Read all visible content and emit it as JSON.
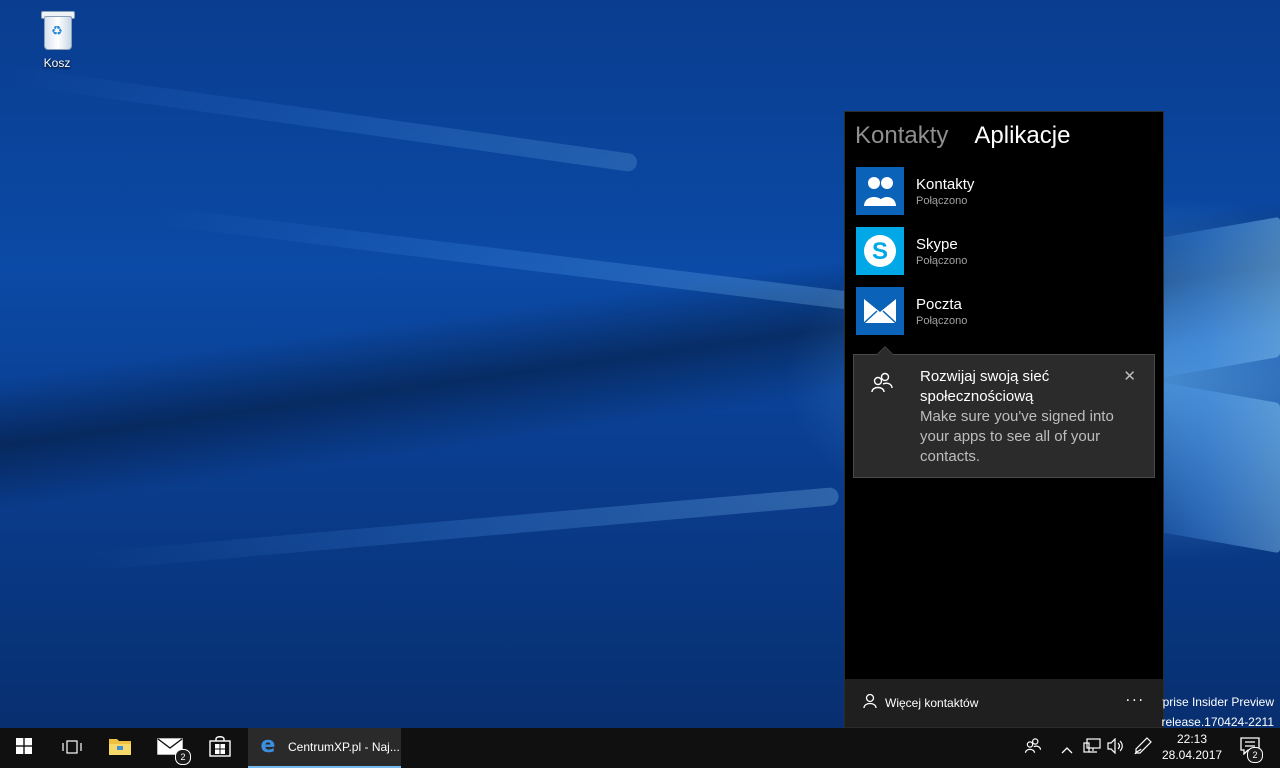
{
  "desktop": {
    "recycle_bin_label": "Kosz"
  },
  "people_panel": {
    "tabs": [
      {
        "label": "Kontakty",
        "active": false
      },
      {
        "label": "Aplikacje",
        "active": true
      }
    ],
    "apps": [
      {
        "name": "Kontakty",
        "status": "Połączono",
        "icon": "people-icon"
      },
      {
        "name": "Skype",
        "status": "Połączono",
        "icon": "skype-icon"
      },
      {
        "name": "Poczta",
        "status": "Połączono",
        "icon": "mail-icon"
      }
    ],
    "callout": {
      "title": "Rozwijaj swoją sieć społecznościową",
      "body": "Make sure you've signed into your apps to see all of your contacts.",
      "close_glyph": "✕"
    },
    "footer": {
      "more_contacts_label": "Więcej kontaktów",
      "more_glyph": "···"
    }
  },
  "watermark": {
    "line1": "rprise Insider Preview",
    "line2": "erelease.170424-2211"
  },
  "taskbar": {
    "mail_badge": "2",
    "edge_label": "CentrumXP.pl - Naj...",
    "clock_time": "22:13",
    "clock_date": "28.04.2017",
    "notifications_badge": "2"
  },
  "colors": {
    "accent": "#0a63b8",
    "panel_bg": "#000000",
    "taskbar_bg": "#101010"
  }
}
